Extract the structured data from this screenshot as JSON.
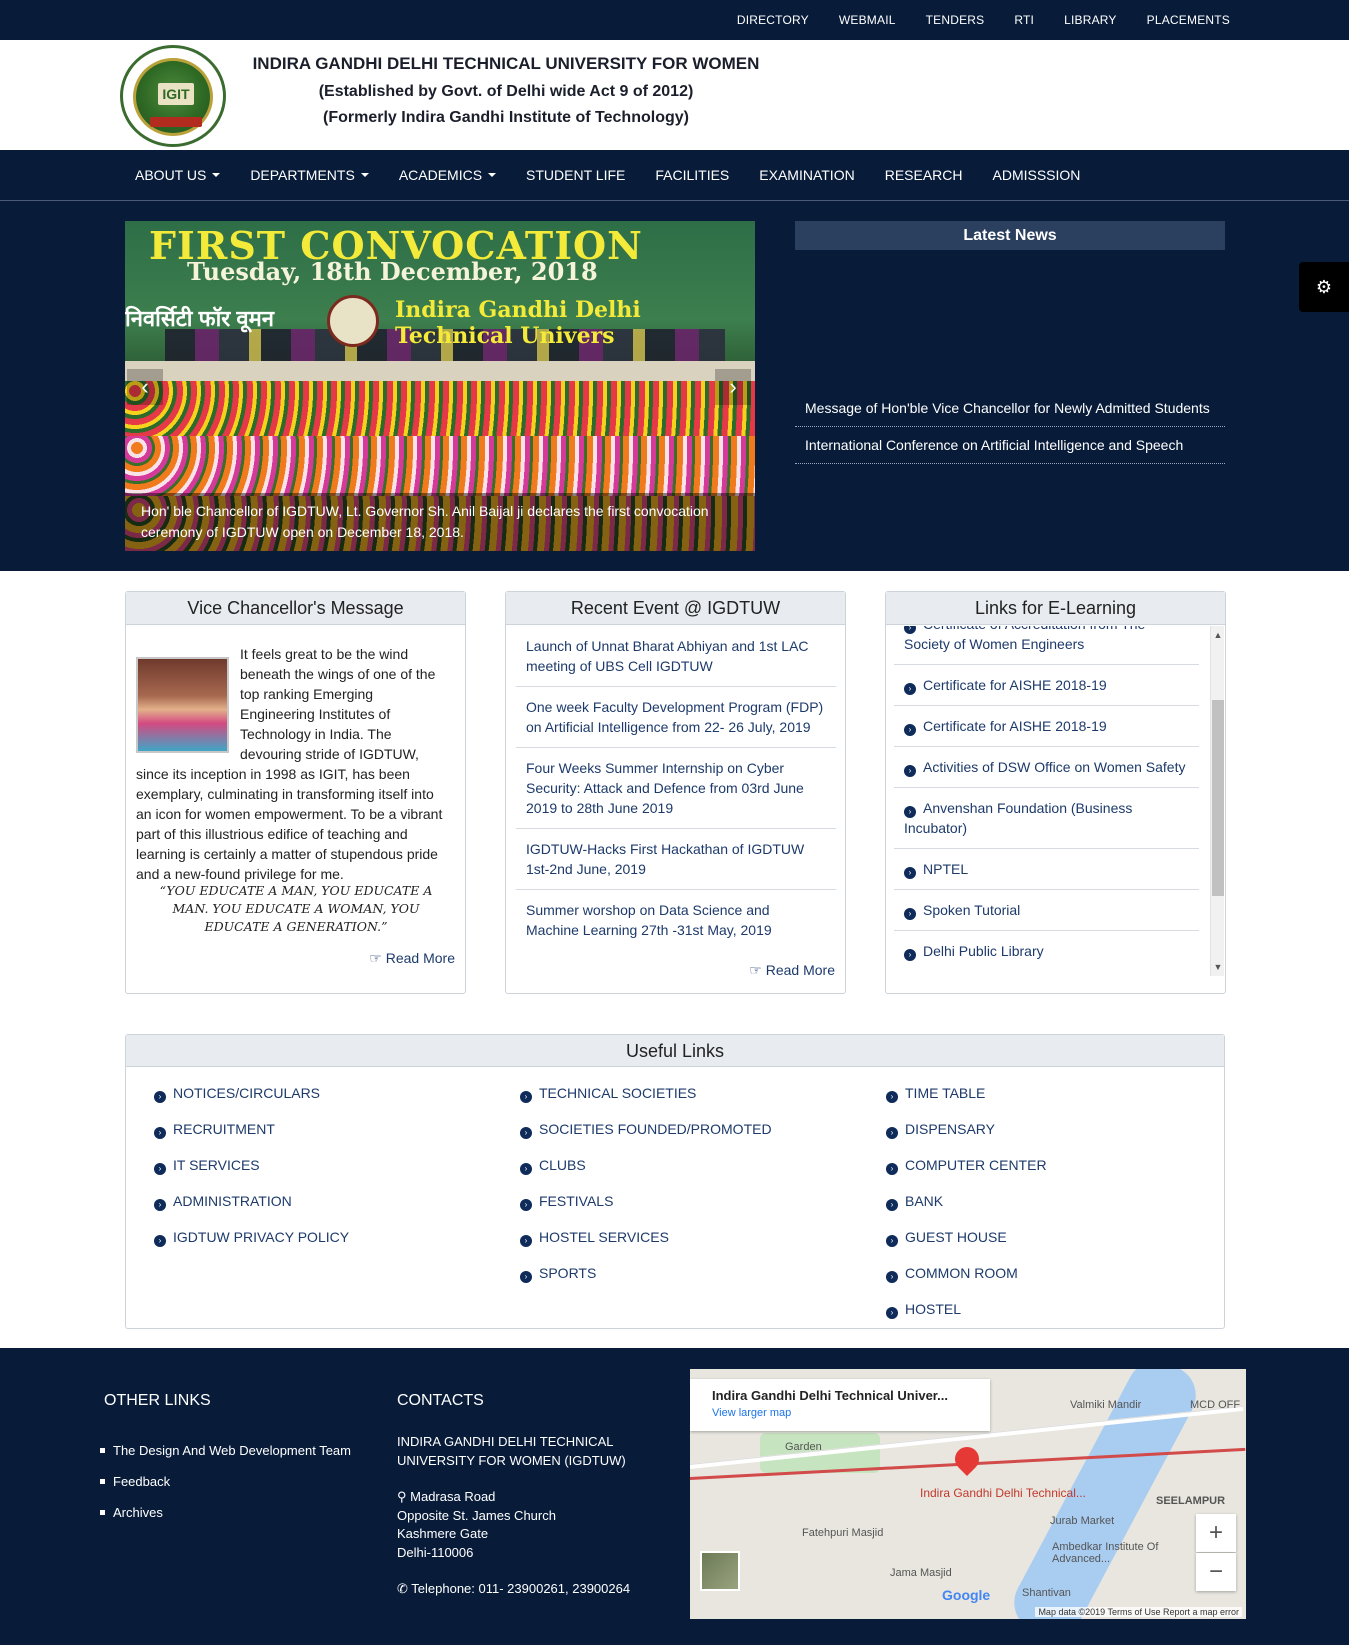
{
  "top_links": [
    "DIRECTORY",
    "WEBMAIL",
    "TENDERS",
    "RTI",
    "LIBRARY",
    "PLACEMENTS"
  ],
  "brand": {
    "logo_text": "IGIT",
    "title": "INDIRA GANDHI DELHI TECHNICAL UNIVERSITY FOR WOMEN",
    "subtitle1": "(Established by Govt. of Delhi wide Act 9 of 2012)",
    "subtitle2": "(Formerly Indira Gandhi Institute of Technology)"
  },
  "nav": [
    "ABOUT US",
    "DEPARTMENTS",
    "ACADEMICS",
    "STUDENT LIFE",
    "FACILITIES",
    "EXAMINATION",
    "RESEARCH",
    "ADMISSSION"
  ],
  "slider": {
    "headline": "FIRST CONVOCATION",
    "date": "Tuesday, 18th December, 2018",
    "hindi": "निवर्सिटी फॉर वूमन",
    "banner": "Indira Gandhi Delhi Technical Univers",
    "caption": "Hon' ble Chancellor of IGDTUW, Lt. Governor Sh. Anil Baijal ji declares the first convocation ceremony of IGDTUW open on December 18, 2018.",
    "prev": "‹",
    "next": "›"
  },
  "news": {
    "title": "Latest News",
    "items": [
      "Message of Hon'ble Vice Chancellor for Newly Admitted Students",
      "International Conference on Artificial Intelligence and Speech"
    ]
  },
  "gear_icon": "⚙",
  "vc": {
    "title": "Vice Chancellor's Message",
    "message": "It feels great to be the wind beneath the wings of one of the top ranking Emerging Engineering Institutes of Technology in India. The devouring stride of IGDTUW, since its inception in 1998 as IGIT, has been exemplary, culminating in transforming itself into an icon for women empowerment. To be a vibrant part of this illustrious edifice of teaching and learning is certainly a matter of stupendous pride and a new-found privilege for me.",
    "quote": "“YOU EDUCATE A MAN, YOU EDUCATE A MAN. YOU EDUCATE A WOMAN, YOU EDUCATE A GENERATION.”",
    "read_more": "Read More"
  },
  "events": {
    "title": "Recent Event @ IGDTUW",
    "items": [
      "Launch of Unnat Bharat Abhiyan and 1st LAC meeting of UBS Cell IGDTUW",
      "One week Faculty Development Program (FDP) on Artificial Intelligence from 22- 26 July, 2019",
      "Four Weeks Summer Internship on Cyber Security: Attack and Defence from 03rd June 2019 to 28th June 2019",
      "IGDTUW-Hacks First Hackathan of IGDTUW 1st-2nd June, 2019",
      "Summer worshop on Data Science and Machine Learning 27th -31st May, 2019"
    ],
    "read_more": "Read More"
  },
  "elearning": {
    "title": "Links for E-Learning",
    "items": [
      "Certificate of Accreditation from The Society of Women Engineers",
      "Certificate for AISHE 2018-19",
      "Certificate for AISHE 2018-19",
      "Activities of DSW Office on Women Safety",
      "Anvenshan Foundation (Business Incubator)",
      "NPTEL",
      "Spoken Tutorial",
      "Delhi Public Library"
    ]
  },
  "useful": {
    "title": "Useful Links",
    "col1": [
      "NOTICES/CIRCULARS",
      "RECRUITMENT",
      "IT SERVICES",
      "ADMINISTRATION",
      "IGDTUW PRIVACY POLICY"
    ],
    "col2": [
      "TECHNICAL SOCIETIES",
      "SOCIETIES FOUNDED/PROMOTED",
      "CLUBS",
      "FESTIVALS",
      "HOSTEL SERVICES",
      "SPORTS"
    ],
    "col3": [
      "TIME TABLE",
      "DISPENSARY",
      "COMPUTER CENTER",
      "BANK",
      "GUEST HOUSE",
      "COMMON ROOM",
      "HOSTEL"
    ]
  },
  "footer": {
    "other_links_title": "OTHER LINKS",
    "other_links": [
      "The Design And Web Development Team",
      "Feedback",
      "Archives"
    ],
    "contacts_title": "CONTACTS",
    "org": "INDIRA GANDHI DELHI TECHNICAL UNIVERSITY FOR WOMEN (IGDTUW)",
    "address1": "Madrasa Road",
    "address2": "Opposite St. James Church",
    "address3": "Kashmere Gate",
    "address4": "Delhi-110006",
    "phone": "Telephone: 011- 23900261, 23900264"
  },
  "map": {
    "card_title": "Indira Gandhi Delhi Technical Univer...",
    "card_link": "View larger map",
    "pin_label": "Indira Gandhi Delhi Technical...",
    "labels": [
      "Valmiki Mandir",
      "MCD OFF",
      "Garden",
      "SEELAMPUR",
      "Jurab Market",
      "Fatehpuri Masjid",
      "Ambedkar Institute Of Advanced...",
      "Jama Masjid",
      "Shantivan"
    ],
    "zoom_in": "+",
    "zoom_out": "−",
    "google": "Google",
    "attribution": "Map data ©2019   Terms of Use   Report a map error"
  }
}
